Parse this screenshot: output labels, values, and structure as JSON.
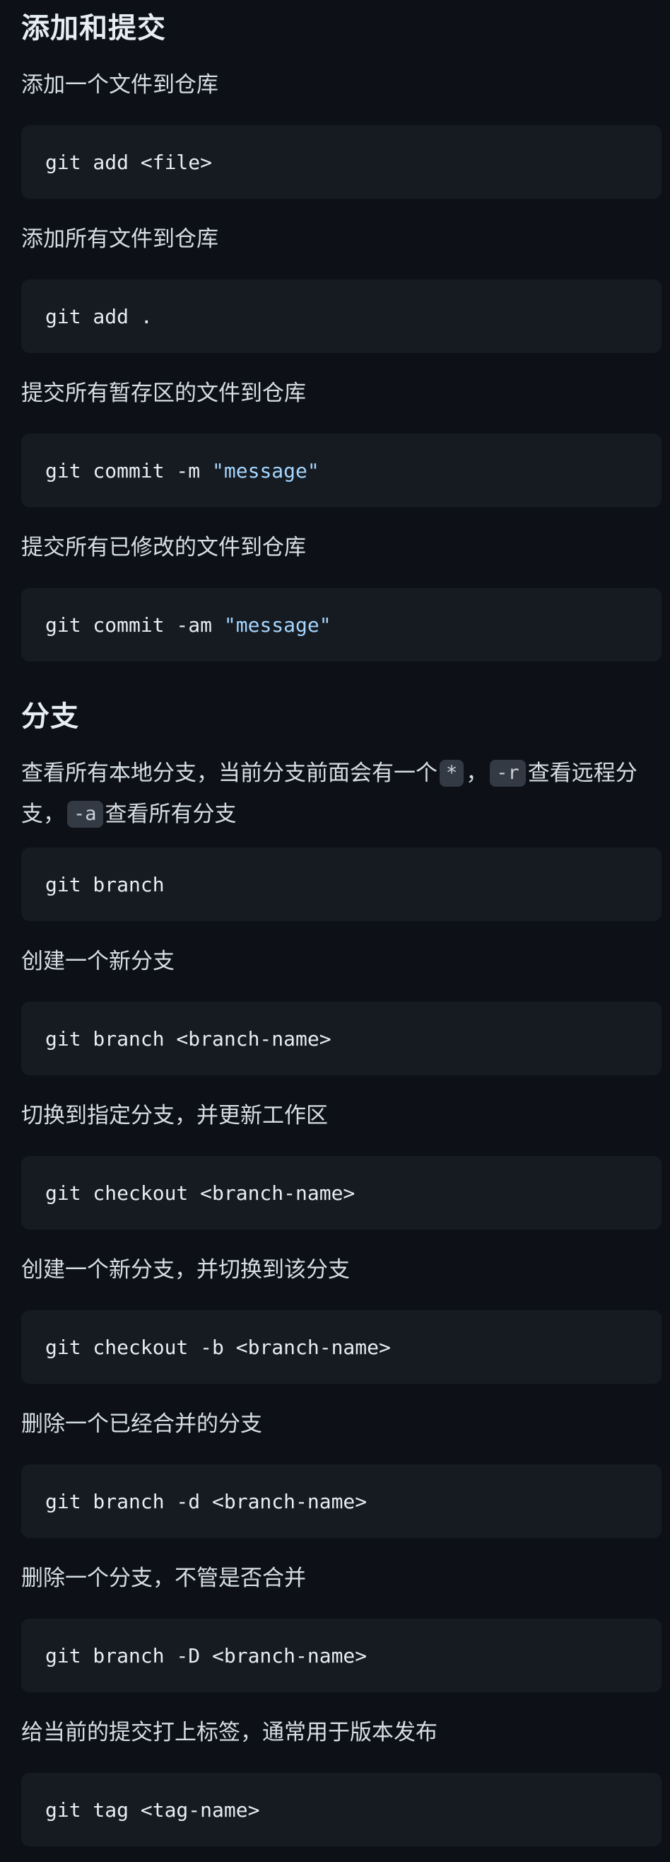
{
  "sections": [
    {
      "title": "添加和提交",
      "items": [
        {
          "desc": "添加一个文件到仓库",
          "code": "git add <file>"
        },
        {
          "desc": "添加所有文件到仓库",
          "code": "git add ."
        },
        {
          "desc": "提交所有暂存区的文件到仓库",
          "code": "git commit -m ",
          "code_string": "\"message\""
        },
        {
          "desc": "提交所有已修改的文件到仓库",
          "code": "git commit -am ",
          "code_string": "\"message\""
        }
      ]
    },
    {
      "title": "分支",
      "intro": {
        "part1": "查看所有本地分支，当前分支前面会有一个",
        "code1": "*",
        "part2": "，",
        "code2": "-r",
        "part3": "查看远程分支，",
        "code3": "-a",
        "part4": "查看所有分支"
      },
      "items": [
        {
          "code": "git branch"
        },
        {
          "desc": "创建一个新分支",
          "code": "git branch <branch-name>"
        },
        {
          "desc": "切换到指定分支，并更新工作区",
          "code": "git checkout <branch-name>"
        },
        {
          "desc": "创建一个新分支，并切换到该分支",
          "code": "git checkout -b <branch-name>"
        },
        {
          "desc": "删除一个已经合并的分支",
          "code": "git branch -d <branch-name>"
        },
        {
          "desc": "删除一个分支，不管是否合并",
          "code": "git branch -D <branch-name>"
        },
        {
          "desc": "给当前的提交打上标签，通常用于版本发布",
          "code": "git tag <tag-name>"
        }
      ]
    }
  ]
}
